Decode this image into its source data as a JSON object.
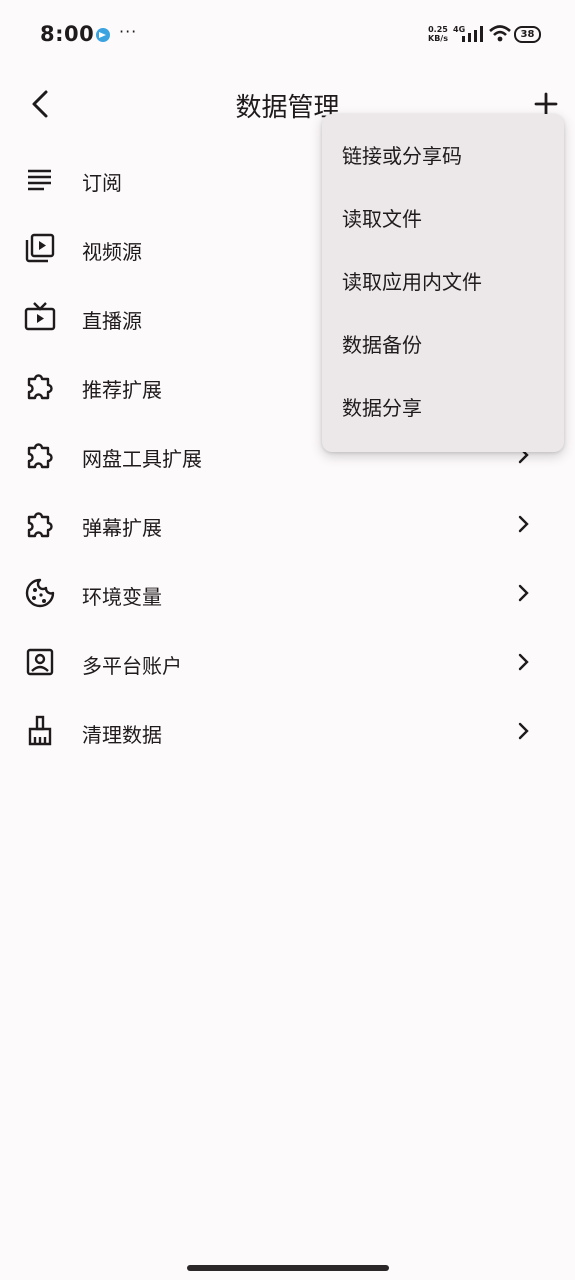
{
  "status_bar": {
    "time": "8:00",
    "more": "···",
    "net_speed_value": "0.25",
    "net_speed_unit": "KB/s",
    "network_type": "4G",
    "battery": "38"
  },
  "header": {
    "title": "数据管理"
  },
  "list": {
    "items": [
      {
        "label": "订阅",
        "icon": "lines-icon"
      },
      {
        "label": "视频源",
        "icon": "video-library-icon"
      },
      {
        "label": "直播源",
        "icon": "live-tv-icon"
      },
      {
        "label": "推荐扩展",
        "icon": "puzzle-icon"
      },
      {
        "label": "网盘工具扩展",
        "icon": "puzzle-icon"
      },
      {
        "label": "弹幕扩展",
        "icon": "puzzle-icon"
      },
      {
        "label": "环境变量",
        "icon": "cookie-icon"
      },
      {
        "label": "多平台账户",
        "icon": "account-box-icon"
      },
      {
        "label": "清理数据",
        "icon": "broom-icon"
      }
    ]
  },
  "menu": {
    "items": [
      {
        "label": "链接或分享码"
      },
      {
        "label": "读取文件"
      },
      {
        "label": "读取应用内文件"
      },
      {
        "label": "数据备份"
      },
      {
        "label": "数据分享"
      }
    ]
  },
  "colors": {
    "background": "#fdfafb",
    "menu_background": "#ece8ea",
    "text": "#1f1b1d",
    "telegram": "#3aa3e0"
  }
}
